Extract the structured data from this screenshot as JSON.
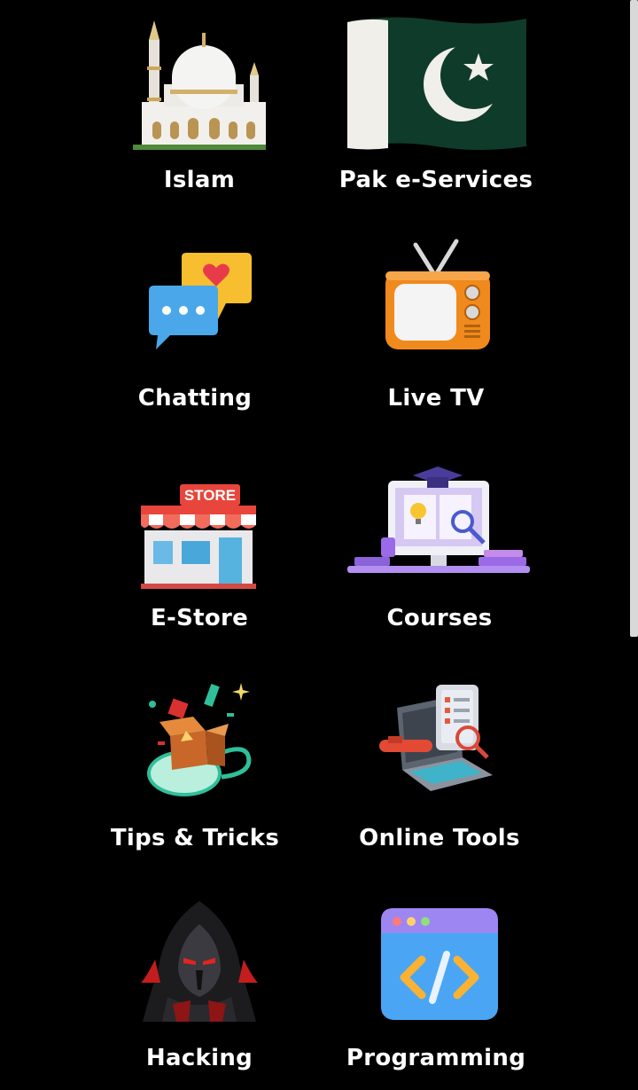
{
  "colors": {
    "background": "#000000",
    "label": "#ffffff",
    "scrollbar": "#d9d9d9"
  },
  "tiles": [
    {
      "label": "Islam",
      "icon": "mosque-icon"
    },
    {
      "label": "Pak e-Services",
      "icon": "pakistan-flag-icon"
    },
    {
      "label": "Chatting",
      "icon": "chat-bubbles-icon"
    },
    {
      "label": "Live TV",
      "icon": "retro-tv-icon"
    },
    {
      "label": "E-Store",
      "icon": "store-icon",
      "sign": "STORE"
    },
    {
      "label": "Courses",
      "icon": "online-course-icon"
    },
    {
      "label": "Tips & Tricks",
      "icon": "gift-box-icon"
    },
    {
      "label": "Online Tools",
      "icon": "laptop-tools-icon"
    },
    {
      "label": "Hacking",
      "icon": "hacker-icon"
    },
    {
      "label": "Programming",
      "icon": "code-window-icon"
    }
  ]
}
